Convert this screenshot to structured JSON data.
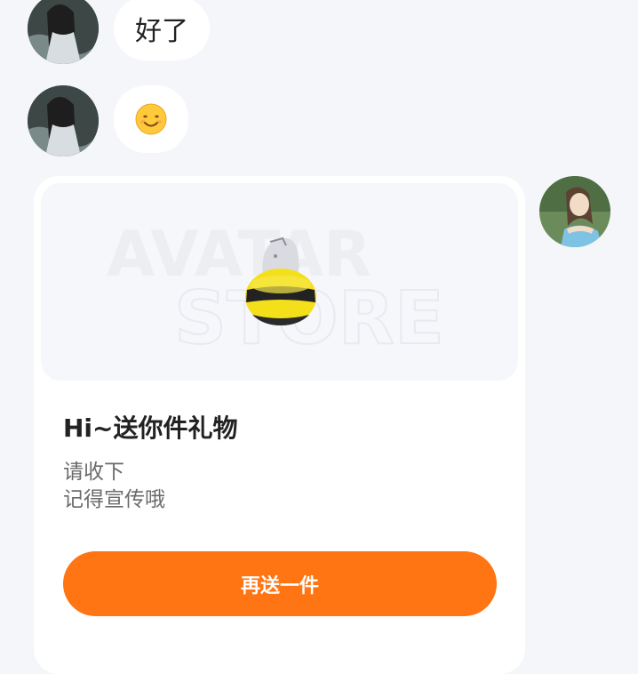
{
  "messages": [
    {
      "text": "好了",
      "sender": "other"
    },
    {
      "text": "😊",
      "sender": "other",
      "icon": "smile-emoji-icon"
    }
  ],
  "gift_card": {
    "title": "Hi~送你件礼物",
    "desc_line1": "请收下",
    "desc_line2": "记得宣传哦",
    "button_label": "再送一件",
    "watermark_line1": "AVATAR",
    "watermark_line2": "STORE",
    "item_icon": "bee-plush-icon"
  },
  "colors": {
    "accent": "#ff7413",
    "background": "#f4f6fa",
    "bubble": "#ffffff"
  }
}
